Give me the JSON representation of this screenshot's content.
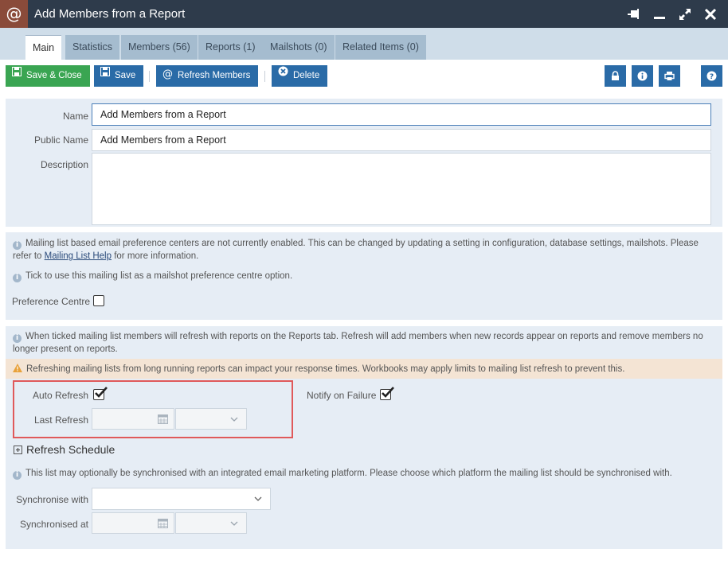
{
  "window": {
    "app_icon": "@",
    "title": "Add Members from a Report",
    "controls": [
      "pin-icon",
      "minimize-icon",
      "maximize-icon",
      "close-icon"
    ]
  },
  "tabs": [
    {
      "label": "Main",
      "active": true
    },
    {
      "label": "Statistics"
    },
    {
      "label": "Members (56)"
    },
    {
      "label": "Reports (1)"
    },
    {
      "label": "Mailshots (0)"
    },
    {
      "label": "Related Items (0)"
    }
  ],
  "toolbar": {
    "save_close": "Save & Close",
    "save": "Save",
    "refresh_members": "Refresh Members",
    "delete": "Delete",
    "right_icons": [
      "lock-icon",
      "info-icon",
      "print-icon",
      "help-icon"
    ]
  },
  "form": {
    "name_label": "Name",
    "name_value": "Add Members from a Report",
    "public_name_label": "Public Name",
    "public_name_value": "Add Members from a Report",
    "description_label": "Description",
    "description_value": ""
  },
  "preference": {
    "info1_before": "Mailing list based email preference centers are not currently enabled. This can be changed by updating a setting in configuration, database settings, mailshots. Please refer to ",
    "info1_link": "Mailing List Help",
    "info1_after": " for more information.",
    "info2": "Tick to use this mailing list as a mailshot preference centre option.",
    "label": "Preference Centre",
    "checked": false
  },
  "refresh": {
    "info": "When ticked mailing list members will refresh with reports on the Reports tab. Refresh will add members when new records appear on reports and remove members no longer present on reports.",
    "warning": "Refreshing mailing lists from long running reports can impact your response times. Workbooks may apply limits to mailing list refresh to prevent this.",
    "auto_refresh_label": "Auto Refresh",
    "auto_refresh_checked": true,
    "notify_label": "Notify on Failure",
    "notify_checked": true,
    "last_refresh_label": "Last Refresh",
    "last_refresh_date": "",
    "last_refresh_time": "",
    "schedule_title": "Refresh Schedule"
  },
  "sync": {
    "info": "This list may optionally be synchronised with an integrated email marketing platform. Please choose which platform the mailing list should be synchronised with.",
    "sync_with_label": "Synchronise with",
    "sync_with_value": "",
    "synced_at_label": "Synchronised at",
    "synced_at_date": "",
    "synced_at_time": ""
  }
}
